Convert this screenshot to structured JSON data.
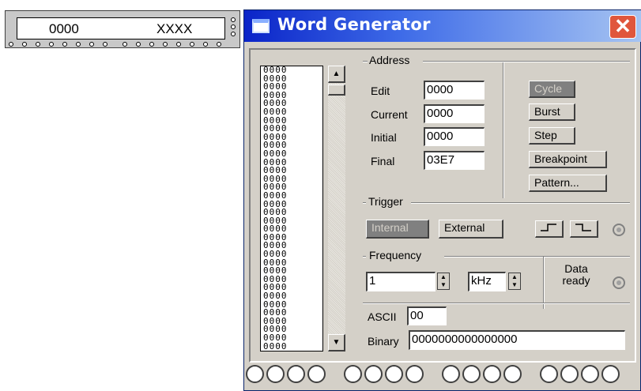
{
  "schematic": {
    "left_value": "0000",
    "right_value": "XXXX"
  },
  "window": {
    "title": "Word Generator",
    "close_label": "✕"
  },
  "data_list": {
    "lines": [
      "0000",
      "0000",
      "0000",
      "0000",
      "0000",
      "0000",
      "0000",
      "0000",
      "0000",
      "0000",
      "0000",
      "0000",
      "0000",
      "0000",
      "0000",
      "0000",
      "0000",
      "0000",
      "0000",
      "0000",
      "0000",
      "0000",
      "0000",
      "0000",
      "0000",
      "0000",
      "0000",
      "0000",
      "0000",
      "0000",
      "0000",
      "0000",
      "0000",
      "0000"
    ]
  },
  "address": {
    "group_label": "Address",
    "edit_label": "Edit",
    "edit_value": "0000",
    "current_label": "Current",
    "current_value": "0000",
    "initial_label": "Initial",
    "initial_value": "0000",
    "final_label": "Final",
    "final_value": "03E7"
  },
  "controls": {
    "cycle": "Cycle",
    "burst": "Burst",
    "step": "Step",
    "breakpoint": "Breakpoint",
    "pattern": "Pattern..."
  },
  "trigger": {
    "group_label": "Trigger",
    "internal": "Internal",
    "external": "External"
  },
  "frequency": {
    "group_label": "Frequency",
    "value": "1",
    "unit": "kHz",
    "data_ready_label": "Data ready"
  },
  "ascii": {
    "label": "ASCII",
    "value": "00"
  },
  "binary": {
    "label": "Binary",
    "value": "0000000000000000"
  },
  "colors": {
    "title_start": "#0a24c8",
    "title_end": "#a6c4f2",
    "window_bg": "#d4d0c8",
    "close_button": "#e0563c"
  }
}
